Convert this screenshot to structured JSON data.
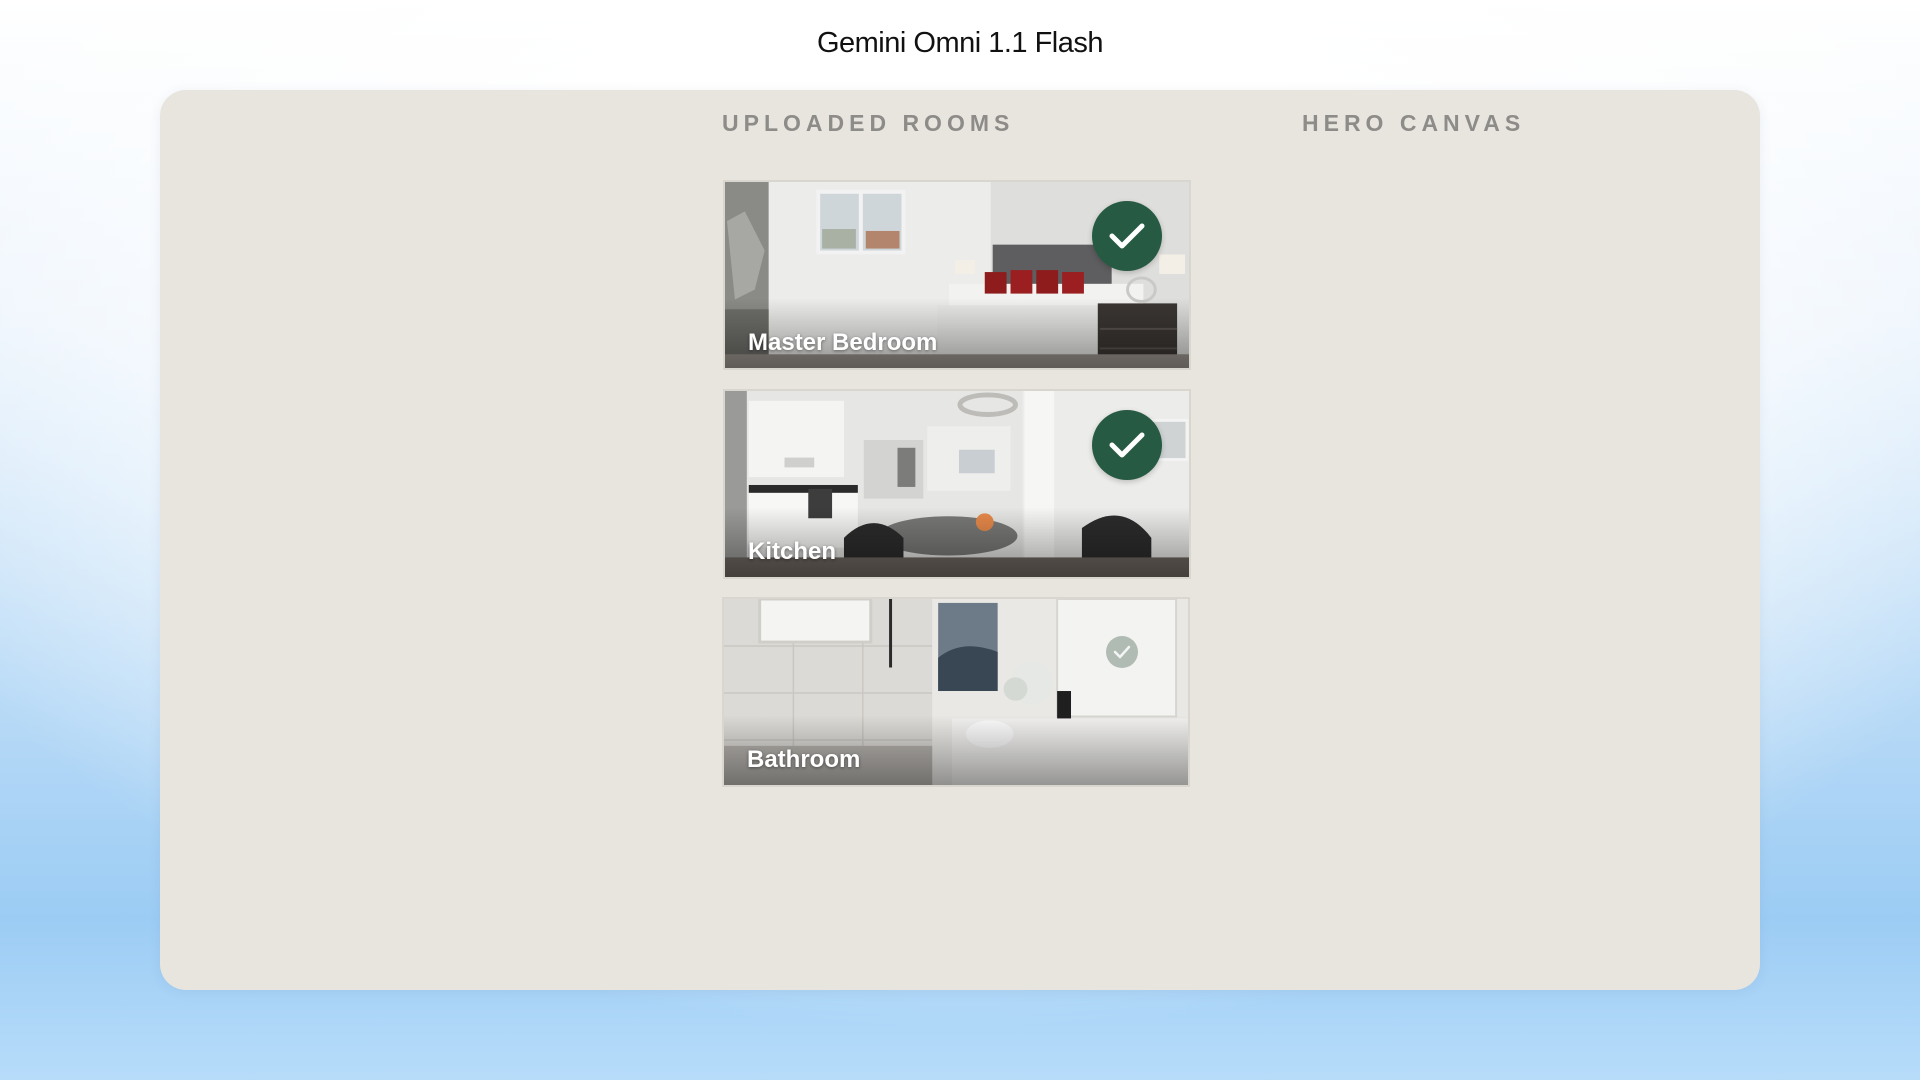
{
  "app": {
    "title": "Gemini Omni 1.1 Flash"
  },
  "sections": {
    "uploaded_rooms": "UPLOADED ROOMS",
    "hero_canvas": "HERO CANVAS"
  },
  "rooms": [
    {
      "label": "Master Bedroom",
      "status": "selected",
      "icon": "check-icon"
    },
    {
      "label": "Kitchen",
      "status": "selected",
      "icon": "check-icon"
    },
    {
      "label": "Bathroom",
      "status": "pending",
      "icon": "check-icon"
    }
  ],
  "colors": {
    "panel_background": "#e8e5df",
    "check_badge": "#275a43",
    "section_title": "#8d8c88"
  }
}
